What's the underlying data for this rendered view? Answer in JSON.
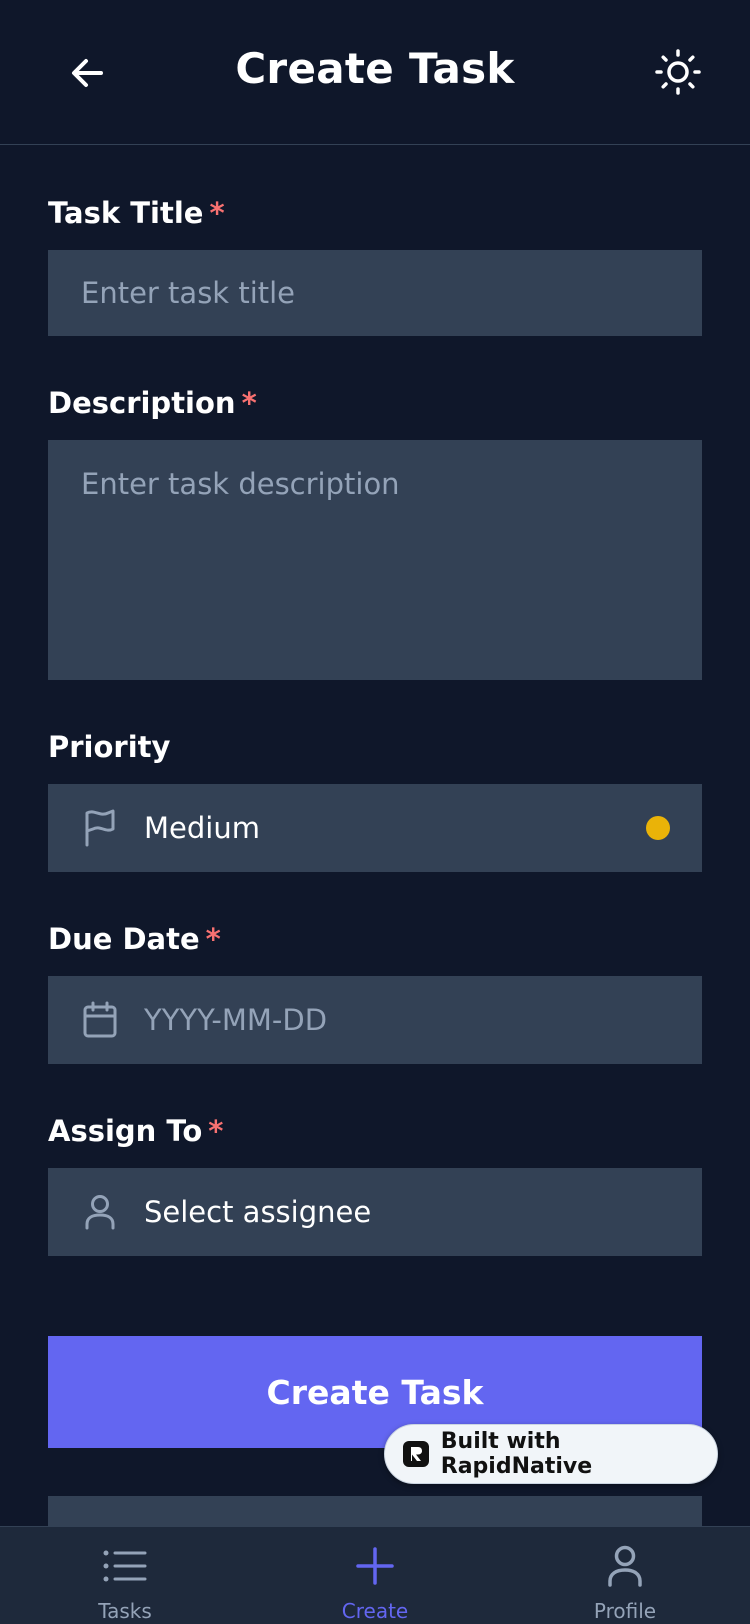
{
  "header": {
    "title": "Create Task",
    "back_icon": "arrow-left-icon",
    "theme_icon": "sun-icon"
  },
  "form": {
    "title": {
      "label": "Task Title",
      "required": "*",
      "placeholder": "Enter task title"
    },
    "description": {
      "label": "Description",
      "required": "*",
      "placeholder": "Enter task description"
    },
    "priority": {
      "label": "Priority",
      "value": "Medium",
      "icon": "flag-icon",
      "dot_color": "#eab308"
    },
    "due_date": {
      "label": "Due Date",
      "required": "*",
      "placeholder": "YYYY-MM-DD",
      "icon": "calendar-icon"
    },
    "assignee": {
      "label": "Assign To",
      "required": "*",
      "placeholder": "Select assignee",
      "icon": "user-icon"
    }
  },
  "actions": {
    "create_label": "Create Task"
  },
  "badge": {
    "text": "Built with RapidNative"
  },
  "tabbar": {
    "items": [
      {
        "label": "Tasks",
        "icon": "list-icon"
      },
      {
        "label": "Create",
        "icon": "plus-icon",
        "active": true
      },
      {
        "label": "Profile",
        "icon": "user-icon"
      }
    ]
  },
  "colors": {
    "background": "#0f172a",
    "field": "#334155",
    "accent": "#6366f1",
    "required": "#f87171"
  }
}
